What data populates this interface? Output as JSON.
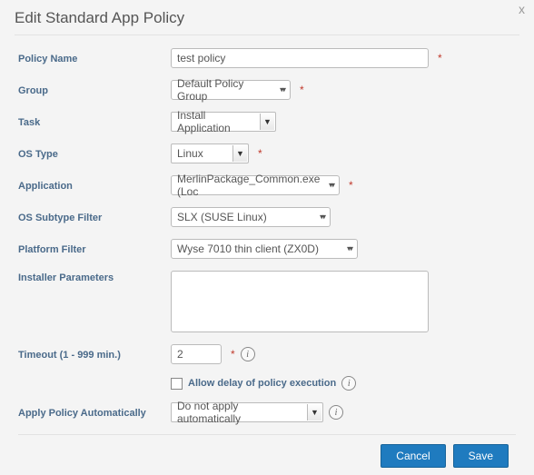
{
  "dialog": {
    "title": "Edit Standard App Policy",
    "close_glyph": "x"
  },
  "labels": {
    "policy_name": "Policy Name",
    "group": "Group",
    "task": "Task",
    "os_type": "OS Type",
    "application": "Application",
    "os_subtype": "OS Subtype Filter",
    "platform": "Platform Filter",
    "installer": "Installer Parameters",
    "timeout": "Timeout (1 - 999 min.)",
    "allow_delay": "Allow delay of policy execution",
    "apply_auto": "Apply Policy Automatically"
  },
  "values": {
    "policy_name": "test policy",
    "group": "Default Policy Group",
    "task": "Install Application",
    "os_type": "Linux",
    "application": "MerlinPackage_Common.exe (Loc",
    "os_subtype": "SLX (SUSE Linux)",
    "platform": "Wyse 7010 thin client (ZX0D)",
    "installer": "",
    "timeout": "2",
    "apply_auto": "Do not apply automatically"
  },
  "icons": {
    "required": "*",
    "info": "i",
    "caret": "▼",
    "caret_db": "▾▾"
  },
  "footer": {
    "cancel": "Cancel",
    "save": "Save"
  }
}
